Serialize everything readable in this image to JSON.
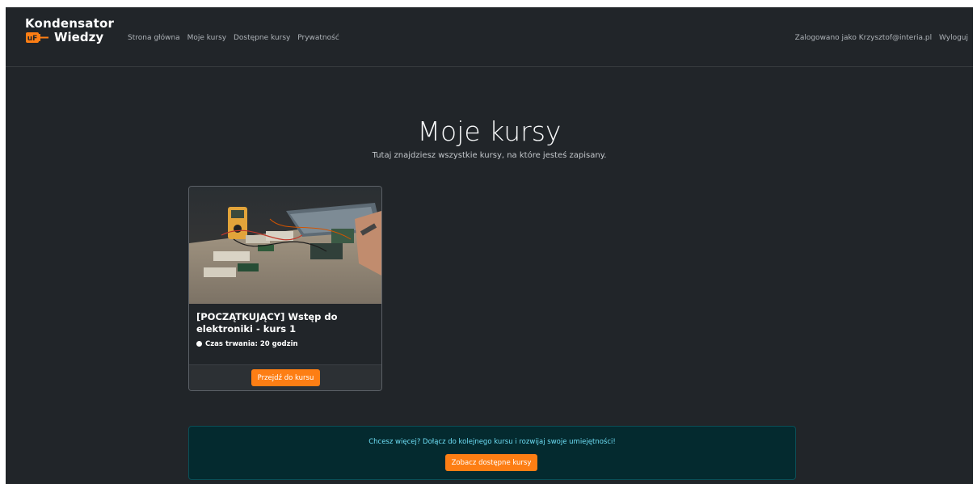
{
  "brand": {
    "line1": "Kondensator",
    "line2": "Wiedzy",
    "badge": "uF"
  },
  "nav": {
    "links": [
      "Strona główna",
      "Moje kursy",
      "Dostępne kursy",
      "Prywatność"
    ],
    "user": "Zalogowano jako Krzysztof@interia.pl",
    "logout": "Wyloguj"
  },
  "page": {
    "title": "Moje kursy",
    "subtitle": "Tutaj znajdziesz wszystkie kursy, na które jesteś zapisany."
  },
  "course": {
    "title": "[POCZĄTKUJĄCY] Wstęp do elektroniki - kurs 1",
    "duration": "Czas trwania: 20 godzin",
    "button": "Przejdź do kursu"
  },
  "banner": {
    "text": "Chcesz więcej? Dołącz do kolejnego kursu i rozwijaj swoje umiejętności!",
    "button": "Zobacz dostępne kursy"
  },
  "colors": {
    "background": "#212529",
    "accent": "#fd7e14",
    "info_bg": "#042a2f",
    "info_text": "#6edff6"
  }
}
